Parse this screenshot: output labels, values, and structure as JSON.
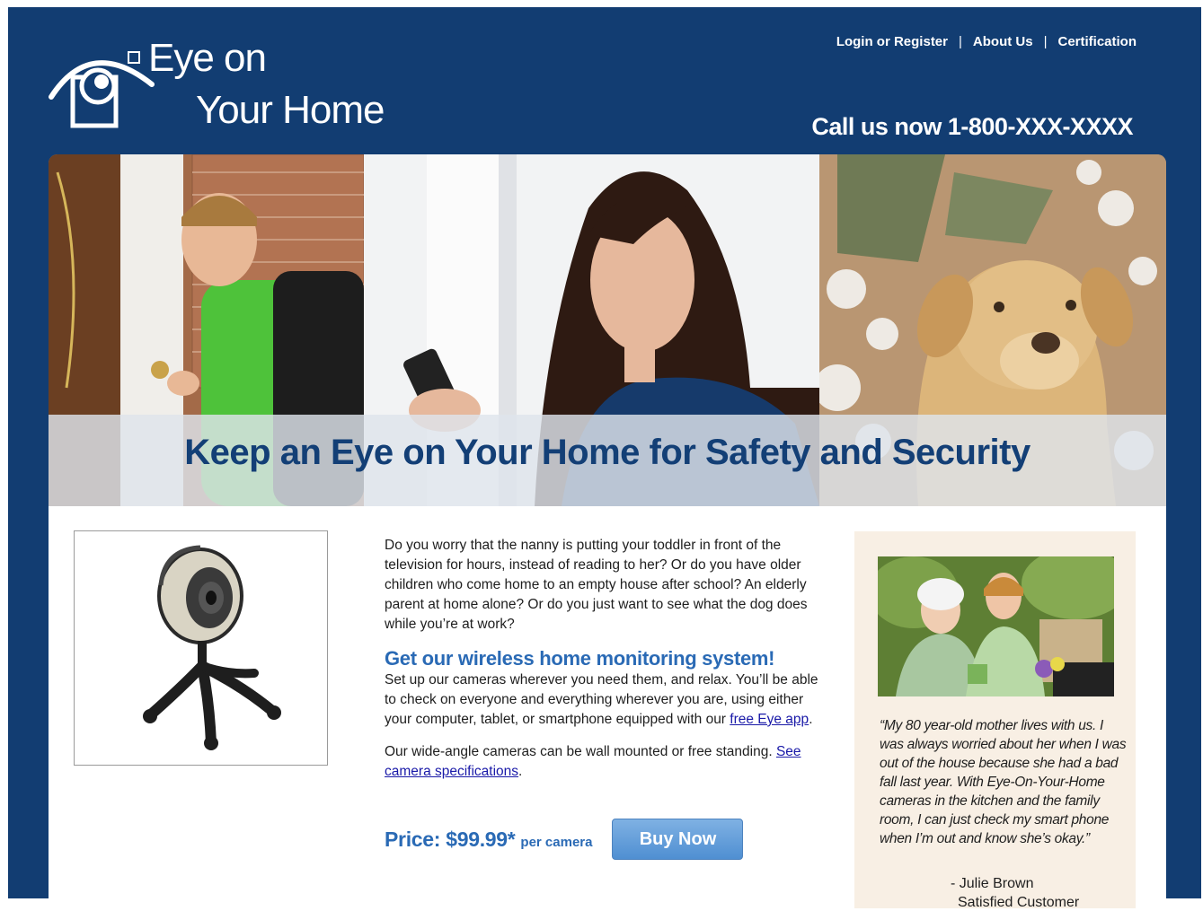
{
  "brand": {
    "logo_line1": "Eye on",
    "logo_line2": "Your Home"
  },
  "nav": {
    "login": "Login or Register",
    "about": "About Us",
    "certification": "Certification",
    "separator": "|"
  },
  "header": {
    "phone": "Call us now 1-800-XXX-XXXX"
  },
  "hero": {
    "title": "Keep an Eye on Your Home for Safety and Security"
  },
  "article": {
    "intro": "Do you worry that the nanny is putting your toddler in front of the television for hours, instead of reading to her?  Or do you have older children who come home to an empty house after school?  An elderly parent at home alone?  Or do you just want to see what the dog does while you’re at work?",
    "heading": "Get our wireless home monitoring system!",
    "body_pre": "Set up our cameras wherever you need them, and relax. You’ll be able to check on everyone and everything wherever you are, using either your computer, tablet, or smartphone equipped with our ",
    "body_link": "free Eye app",
    "body_post": ".",
    "cameras_pre": "Our wide-angle cameras can be wall mounted or free standing.  ",
    "cameras_link": "See camera specifications",
    "cameras_post": "."
  },
  "pricing": {
    "price": "Price: $99.99*",
    "per": "per camera",
    "buy_label": "Buy Now"
  },
  "testimonial": {
    "quote": "“My 80 year-old mother lives with us. I was always worried about her when I was out of the house because she had a bad fall last year. With Eye-On-Your-Home cameras in the kitchen and the family room, I can just check my smart phone when I’m out and know she’s okay.”",
    "name": "- Julie Brown",
    "role": "Satisfied Customer"
  },
  "colors": {
    "brand_navy": "#123d72",
    "accent_blue": "#2a6ab5",
    "button_blue": "#5b98d6",
    "testimonial_bg": "#f8efe4"
  }
}
